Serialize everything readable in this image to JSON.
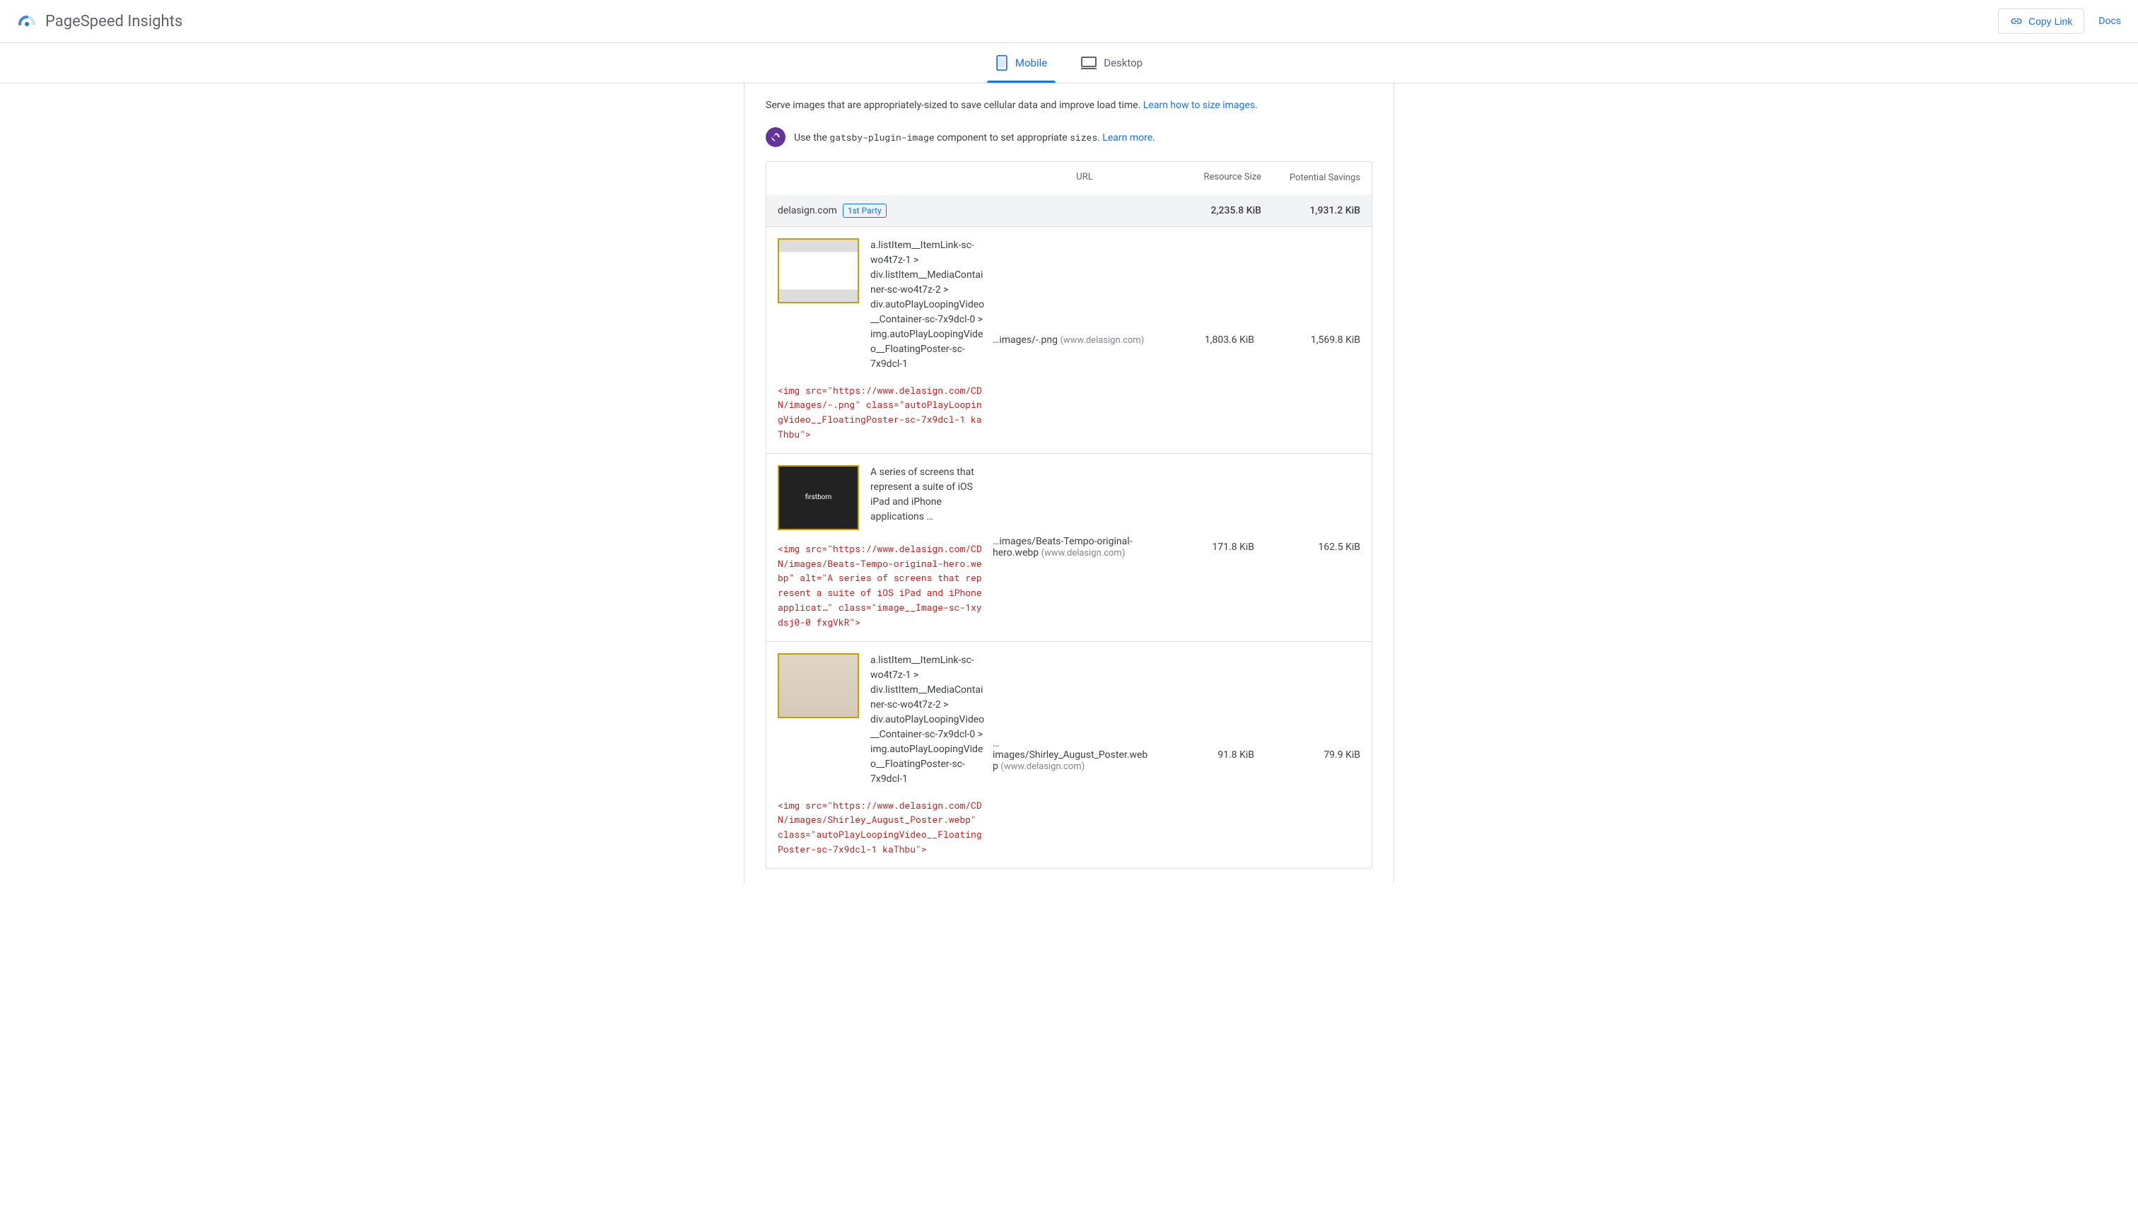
{
  "header": {
    "logo_text": "PageSpeed Insights",
    "copy_link": "Copy Link",
    "docs": "Docs"
  },
  "tabs": {
    "mobile": "Mobile",
    "desktop": "Desktop"
  },
  "audit": {
    "serve_images": "Serve images that are appropriately-sized to save cellular data and improve load time. ",
    "serve_images_link": "Learn how to size images",
    "gatsby_pre": "Use the ",
    "gatsby_code1": "gatsby-plugin-image",
    "gatsby_mid": " component to set appropriate ",
    "gatsby_code2": "sizes",
    "gatsby_post": ". ",
    "gatsby_link": "Learn more"
  },
  "table": {
    "headers": {
      "url": "URL",
      "resource_size": "Resource Size",
      "potential_savings": "Potential Savings"
    },
    "domain": {
      "name": "delasign.com",
      "badge": "1st Party",
      "size": "2,235.8 KiB",
      "savings": "1,931.2 KiB"
    },
    "rows": [
      {
        "selector": "a.listItem__ItemLink-sc-wo4t7z-1 > div.listItem__MediaContainer-sc-wo4t7z-2 > div.autoPlayLoopingVideo__Container-sc-7x9dcl-0 > img.autoPlayLoopingVideo__FloatingPoster-sc-7x9dcl-1",
        "code": "<img src=\"https://www.delasign.com/CDN/images/-.png\" class=\"autoPlayLoopingVideo__FloatingPoster-sc-7x9dcl-1 kaThbu\">",
        "url_path": "…images/-.png",
        "url_domain": "(www.delasign.com)",
        "size": "1,803.6 KiB",
        "savings": "1,569.8 KiB"
      },
      {
        "alt_text": "A series of screens that represent a suite of iOS iPad and iPhone applications …",
        "code": "<img src=\"https://www.delasign.com/CDN/images/Beats-Tempo-original-hero.webp\" alt=\"A series of screens that represent a suite of iOS iPad and iPhone applicat…\" class=\"image__Image-sc-1xydsj0-0 fxgVkR\">",
        "url_path": "…images/Beats-Tempo-original-hero.webp",
        "url_domain": "(www.delasign.com)",
        "size": "171.8 KiB",
        "savings": "162.5 KiB"
      },
      {
        "selector": "a.listItem__ItemLink-sc-wo4t7z-1 > div.listItem__MediaContainer-sc-wo4t7z-2 > div.autoPlayLoopingVideo__Container-sc-7x9dcl-0 > img.autoPlayLoopingVideo__FloatingPoster-sc-7x9dcl-1",
        "code": "<img src=\"https://www.delasign.com/CDN/images/Shirley_August_Poster.webp\" class=\"autoPlayLoopingVideo__FloatingPoster-sc-7x9dcl-1 kaThbu\">",
        "url_path": "…images/Shirley_August_Poster.webp",
        "url_domain": "(www.delasign.com)",
        "size": "91.8 KiB",
        "savings": "79.9 KiB"
      }
    ]
  }
}
